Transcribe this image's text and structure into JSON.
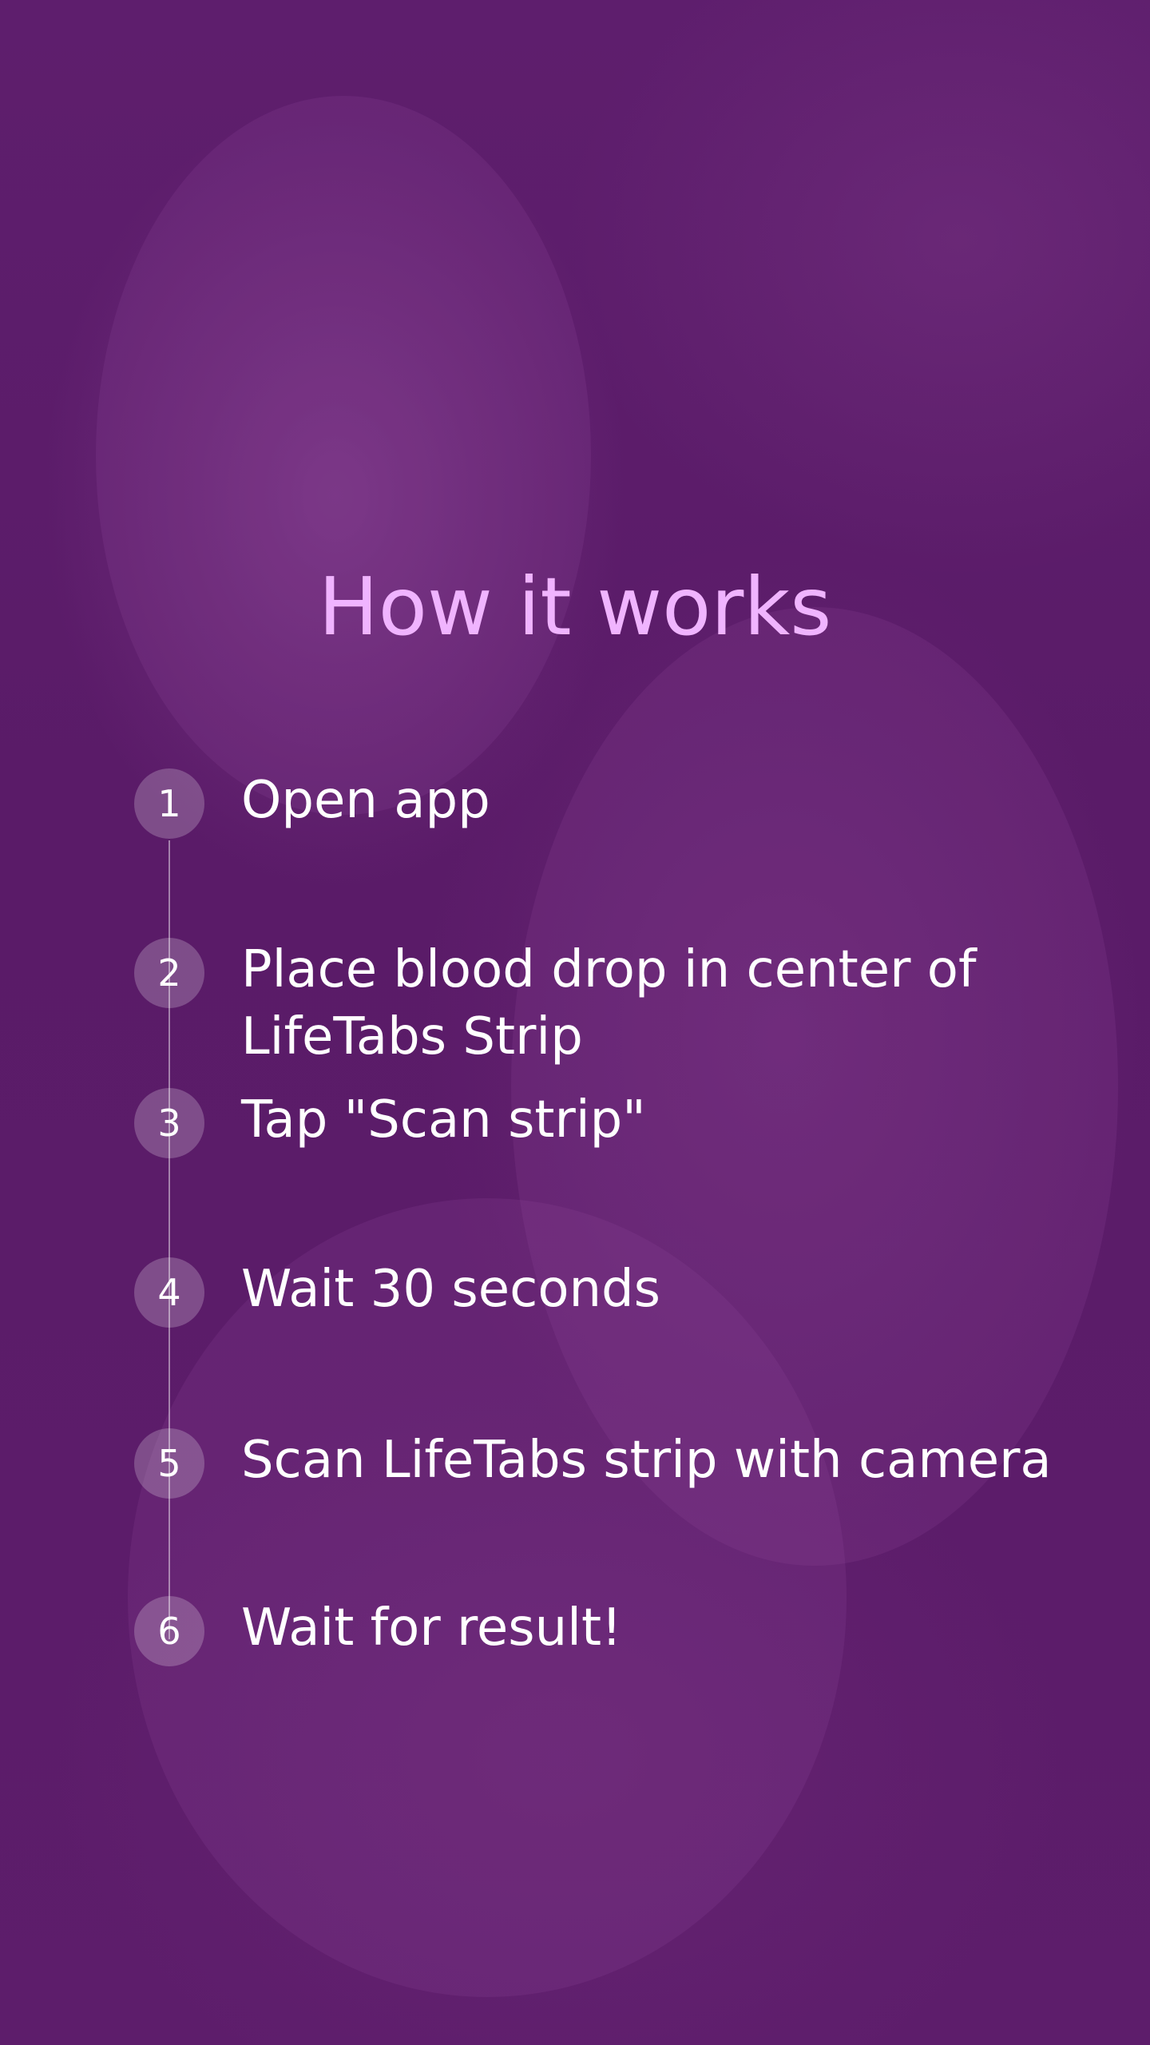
{
  "screen": {
    "title": "How it works"
  },
  "steps": [
    {
      "number": "1",
      "text": "Open app"
    },
    {
      "number": "2",
      "text": "Place blood drop in center of LifeTabs Strip"
    },
    {
      "number": "3",
      "text": "Tap \"Scan strip\""
    },
    {
      "number": "4",
      "text": "Wait 30 seconds"
    },
    {
      "number": "5",
      "text": "Scan LifeTabs strip with camera"
    },
    {
      "number": "6",
      "text": "Wait for result!"
    }
  ],
  "colors": {
    "overlay": "#5f1f6f",
    "title": "#f0b4ff",
    "text": "#ffffff"
  }
}
